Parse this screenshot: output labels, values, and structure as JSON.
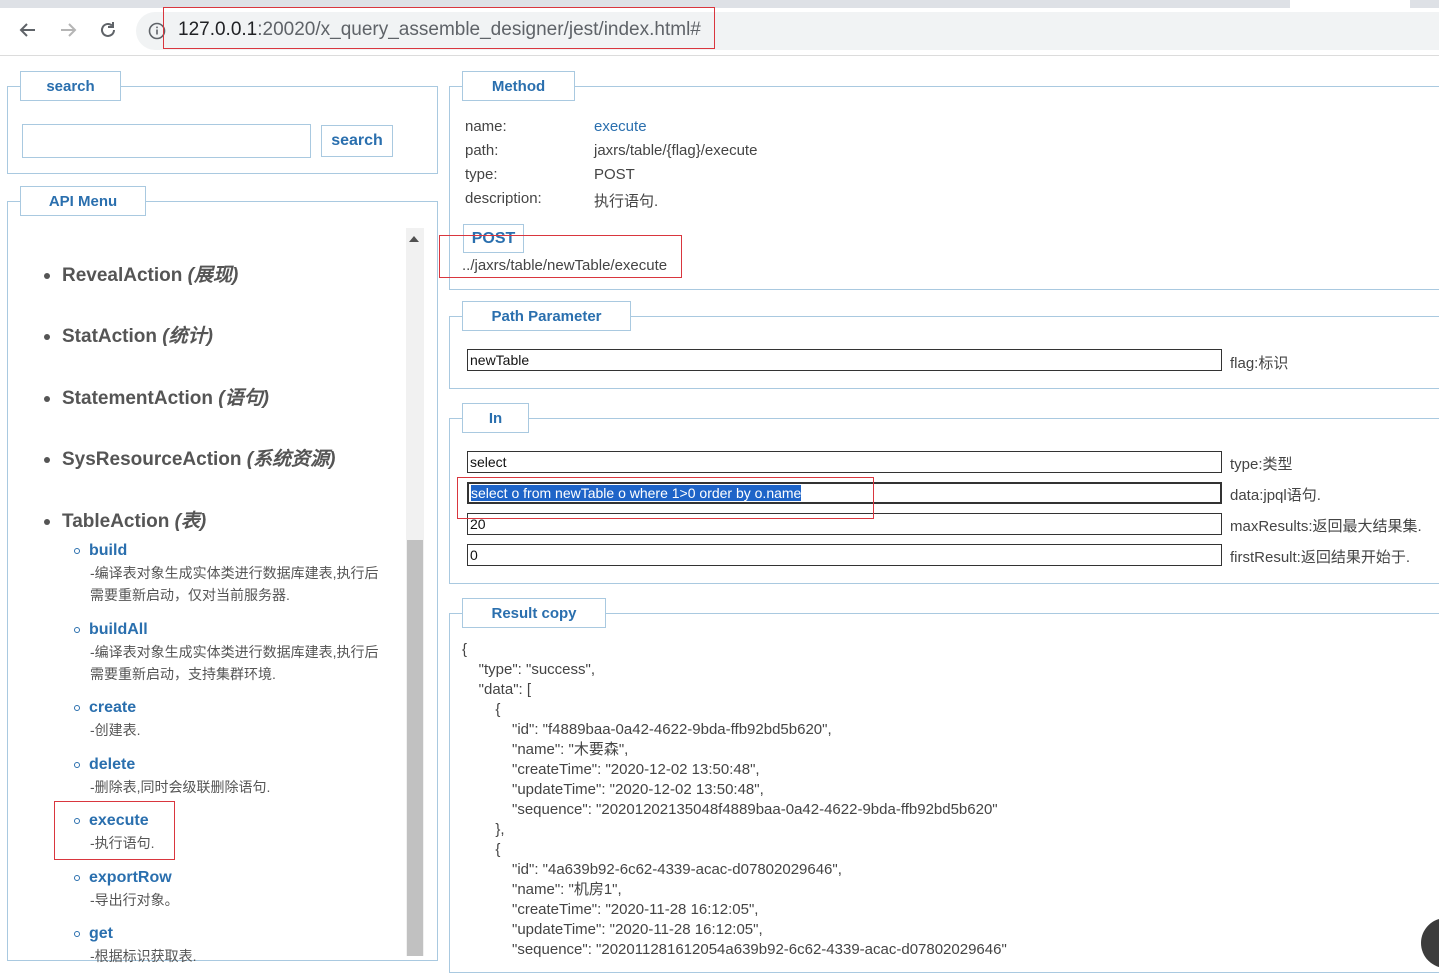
{
  "browser": {
    "url_host": "127.0.0.1",
    "url_rest": ":20020/x_query_assemble_designer/jest/index.html#"
  },
  "search_panel": {
    "legend": "search",
    "button": "search",
    "value": ""
  },
  "api_menu": {
    "legend": "API Menu",
    "categories": [
      {
        "name": "RevealAction",
        "cn": "(展现)"
      },
      {
        "name": "StatAction",
        "cn": "(统计)"
      },
      {
        "name": "StatementAction",
        "cn": "(语句)"
      },
      {
        "name": "SysResourceAction",
        "cn": "(系统资源)"
      },
      {
        "name": "TableAction",
        "cn": "(表)"
      }
    ],
    "items": [
      {
        "name": "build",
        "desc_line1": "-编译表对象生成实体类进行数据库建表,执行后",
        "desc_line2": "需要重新启动，仅对当前服务器."
      },
      {
        "name": "buildAll",
        "desc_line1": "-编译表对象生成实体类进行数据库建表,执行后",
        "desc_line2": "需要重新启动，支持集群环境."
      },
      {
        "name": "create",
        "desc_line1": "-创建表.",
        "desc_line2": ""
      },
      {
        "name": "delete",
        "desc_line1": "-删除表,同时会级联删除语句.",
        "desc_line2": ""
      },
      {
        "name": "execute",
        "desc_line1": "-执行语句.",
        "desc_line2": ""
      },
      {
        "name": "exportRow",
        "desc_line1": "-导出行对象。",
        "desc_line2": ""
      },
      {
        "name": "get",
        "desc_line1": "-根据标识获取表.",
        "desc_line2": ""
      }
    ]
  },
  "method": {
    "legend": "Method",
    "name_key": "name:",
    "name_val": "execute",
    "path_key": "path:",
    "path_val": "jaxrs/table/{flag}/execute",
    "type_key": "type:",
    "type_val": "POST",
    "desc_key": "description:",
    "desc_val": "执行语句.",
    "http": "POST",
    "endpoint": "../jaxrs/table/newTable/execute"
  },
  "path_parameter": {
    "legend": "Path Parameter",
    "flag_value": "newTable",
    "flag_desc": "flag:标识"
  },
  "in": {
    "legend": "In",
    "type_value": "select",
    "type_desc": "type:类型",
    "data_value": "select o from newTable o where 1>0 order by  o.name",
    "data_desc": "data:jpql语句.",
    "max_value": "20",
    "max_desc": "maxResults:返回最大结果集.",
    "first_value": "0",
    "first_desc": "firstResult:返回结果开始于."
  },
  "result": {
    "legend": "Result copy",
    "lines": [
      "{",
      "    \"type\": \"success\",",
      "    \"data\": [",
      "        {",
      "            \"id\": \"f4889baa-0a42-4622-9bda-ffb92bd5b620\",",
      "            \"name\": \"木要森\",",
      "            \"createTime\": \"2020-12-02 13:50:48\",",
      "            \"updateTime\": \"2020-12-02 13:50:48\",",
      "            \"sequence\": \"20201202135048f4889baa-0a42-4622-9bda-ffb92bd5b620\"",
      "        },",
      "        {",
      "            \"id\": \"4a639b92-6c62-4339-acac-d07802029646\",",
      "            \"name\": \"机房1\",",
      "            \"createTime\": \"2020-11-28 16:12:05\",",
      "            \"updateTime\": \"2020-11-28 16:12:05\",",
      "            \"sequence\": \"202011281612054a639b92-6c62-4339-acac-d07802029646\""
    ]
  }
}
